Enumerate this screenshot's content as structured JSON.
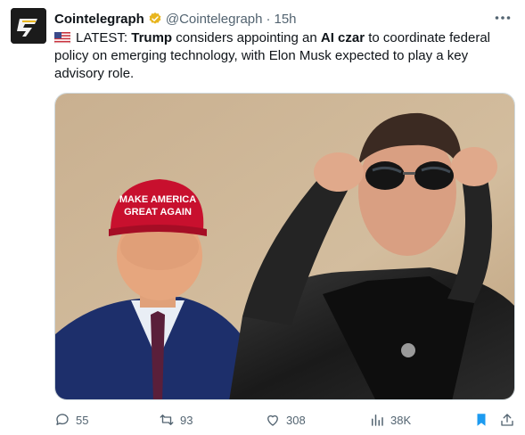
{
  "author": {
    "display_name": "Cointelegraph",
    "handle": "@Cointelegraph",
    "separator": "·",
    "time": "15h"
  },
  "tweet": {
    "flag": "us-flag",
    "part1": "LATEST: ",
    "bold1": "Trump",
    "part2": " considers appointing an ",
    "bold2": "AI czar",
    "part3": " to coordinate federal policy on emerging technology, with Elon Musk expected to play a key advisory role."
  },
  "media": {
    "hat_text_line1": "MAKE AMERICA",
    "hat_text_line2": "GREAT AGAIN"
  },
  "actions": {
    "reply_count": "55",
    "retweet_count": "93",
    "like_count": "308",
    "views_count": "38K"
  },
  "colors": {
    "accent": "#1d9bf0",
    "verified_gold": "#e8b51e",
    "muted": "#536471"
  },
  "icons": {
    "reply": "reply-icon",
    "retweet": "retweet-icon",
    "like": "heart-icon",
    "views": "views-icon",
    "bookmark": "bookmark-icon",
    "share": "share-icon"
  }
}
